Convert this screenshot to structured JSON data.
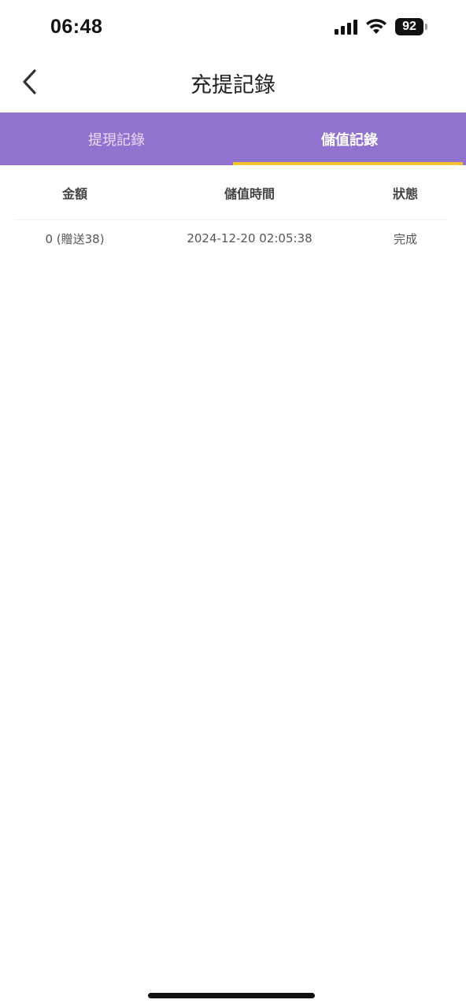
{
  "status_bar": {
    "time": "06:48",
    "battery": "92",
    "icons": [
      "signal-icon",
      "wifi-icon",
      "battery-icon"
    ]
  },
  "nav": {
    "title": "充提記錄",
    "back_icon": "chevron-left-icon"
  },
  "tabs": [
    {
      "label": "提現記錄",
      "active": false
    },
    {
      "label": "儲值記錄",
      "active": true
    }
  ],
  "table": {
    "headers": {
      "amount": "金額",
      "time": "儲值時間",
      "status": "狀態"
    },
    "rows": [
      {
        "amount": "0 (贈送38)",
        "time": "2024-12-20 02:05:38",
        "status": "完成"
      }
    ]
  },
  "colors": {
    "tab_bar": "#9272cf",
    "tab_indicator": "#f2c230"
  }
}
